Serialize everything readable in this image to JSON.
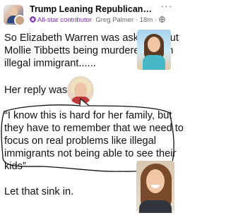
{
  "header": {
    "group_name": "Trump Leaning Republicans in Sp...",
    "badge_label": "All-star contributor",
    "author": "Greg Palmer",
    "separator": "·",
    "time": "18m",
    "more_label": "···",
    "badge_color": "#7a2fb5"
  },
  "post": {
    "line1": "So Elizabeth Warren was asked about",
    "line2": "Mollie Tibbetts being murdered by an",
    "line3": "illegal immigrant......",
    "reply": "Her reply was:",
    "quote1": "“I know this is hard for her family, but",
    "quote2": "they have to remember that we need to",
    "quote3": "focus on real problems like illegal",
    "quote4": "immigrants not being able to see their",
    "quote5": "kids”",
    "closing": "Let that sink in."
  },
  "icons": {
    "badge": "star-badge-icon",
    "visibility": "globe-icon",
    "more": "more-options-icon"
  }
}
